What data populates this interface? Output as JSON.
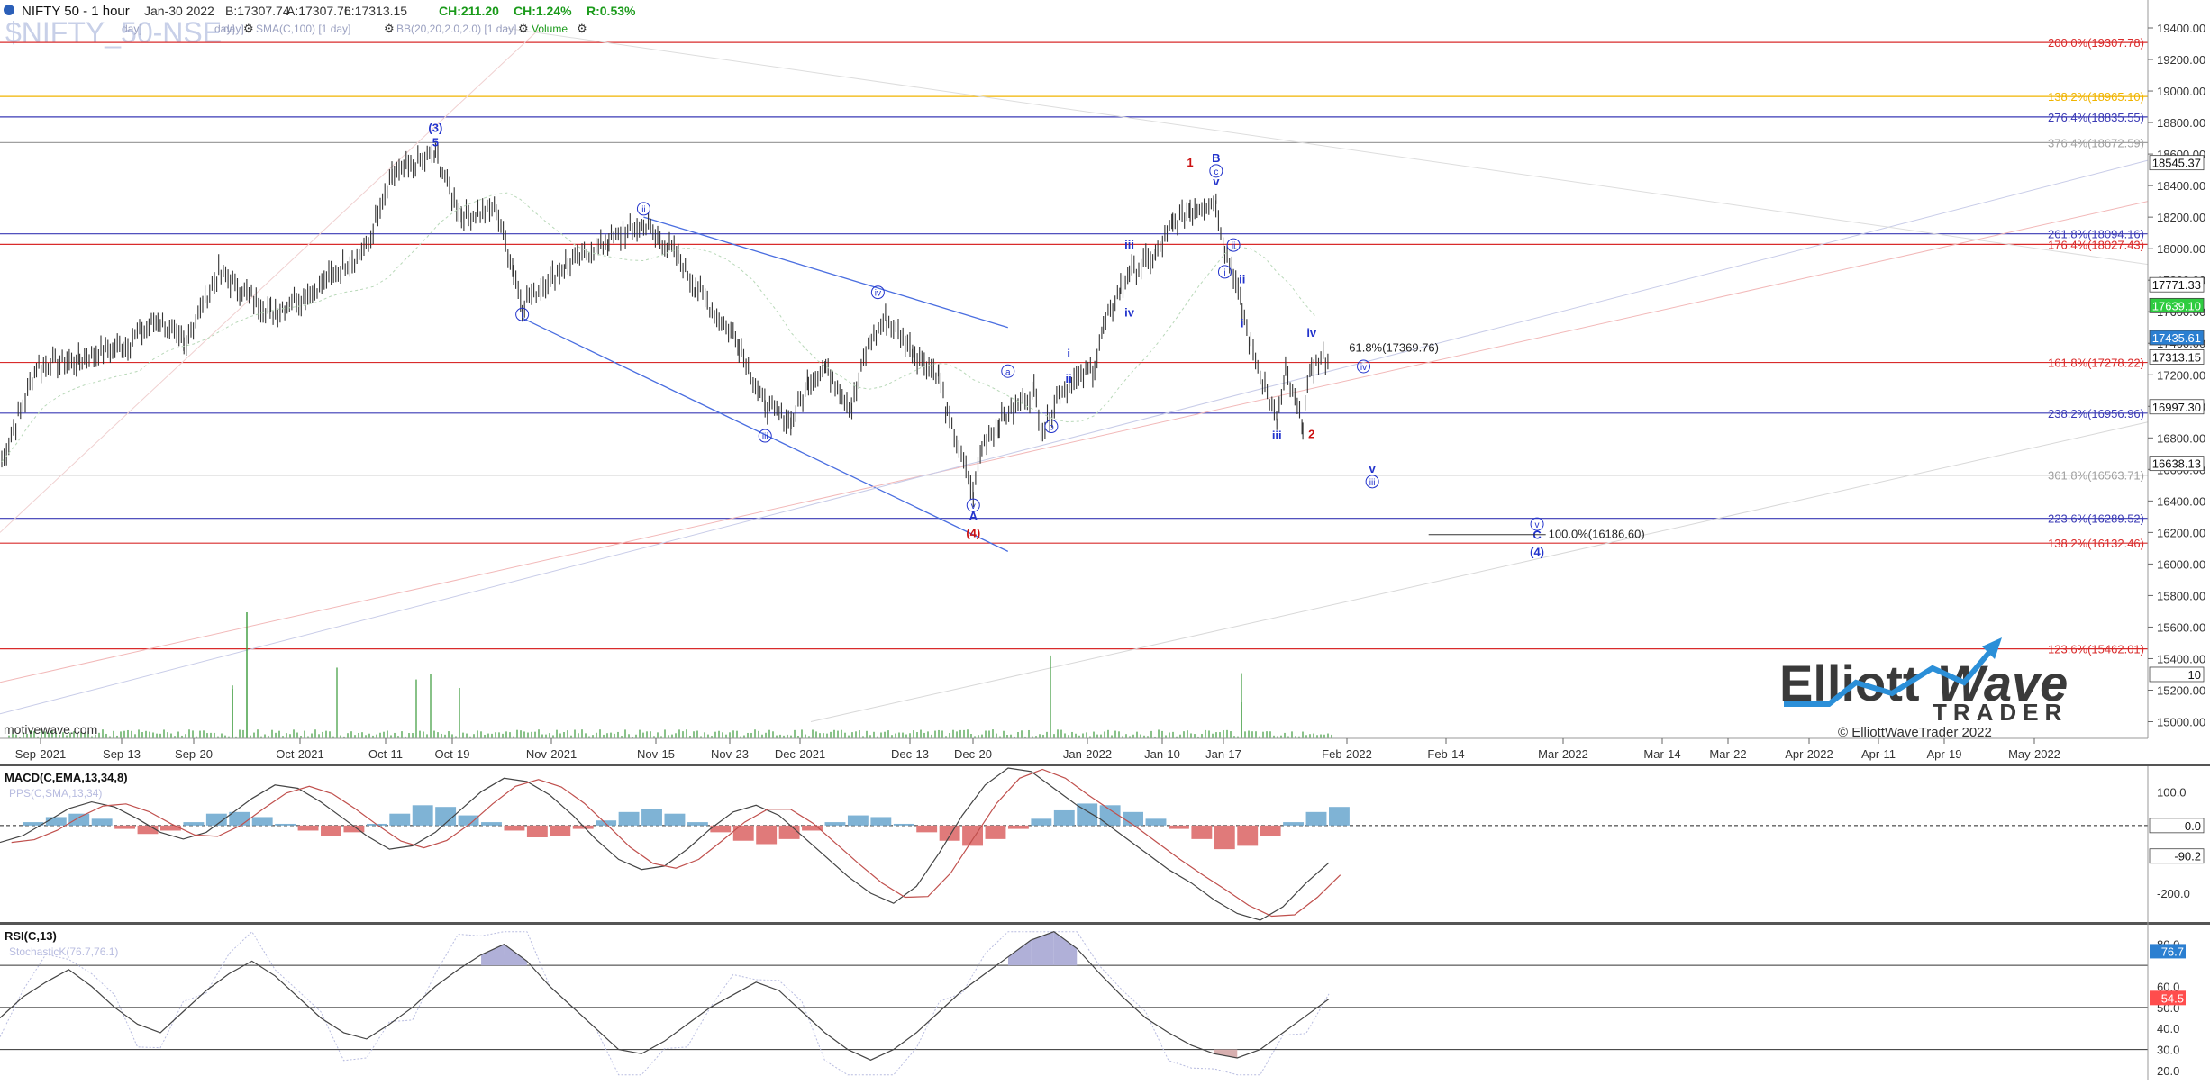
{
  "header": {
    "symbol_line": "NIFTY 50 - 1 hour",
    "quote_date": "Jan-30 2022",
    "bid": "B:17307.74",
    "ask": "A:17307.76",
    "last": "L:17313.15",
    "change": "CH:211.20",
    "change_pct": "CH:1.24%",
    "range": "R:0.53%",
    "watermark": "$NIFTY_50-NSE",
    "ind_sma": "SMA(C,100) [1 day]",
    "ind_bb": "BB(20,20,2.0,2.0) [1 day]",
    "ind_volume": "Volume",
    "ind_day_fragments": [
      "day]",
      "day]",
      "day]"
    ]
  },
  "footer": {
    "source": "motivewave.com",
    "copyright": "© ElliottWaveTrader 2022",
    "logo_word1": "Elliott",
    "logo_word2": "Wave",
    "logo_word3": "TRADER"
  },
  "colors": {
    "price_bars": "#333333",
    "fib_red": "#d92b2b",
    "fib_blue": "#3a3ab5",
    "fib_orange": "#f0b400",
    "fib_grey": "#a0a0a0",
    "wave_blue": "#2233cc",
    "wave_red": "#cc1111",
    "up_hist": "#7fb3d5",
    "down_hist": "#e07a7a",
    "volume": "#3a9a3a",
    "last_price_tag": "#2b7fd1",
    "green_tag": "#2ecc40",
    "rsi_overbought_fill": "#b0b0d8",
    "rsi_oversold_fill": "#d8b0b0"
  },
  "chart_data": [
    {
      "type": "line",
      "panel": "price",
      "title": "NIFTY 50 - 1 hour",
      "x_tick_labels": [
        "Sep-2021",
        "Sep-13",
        "Sep-20",
        "Oct-2021",
        "Oct-11",
        "Oct-19",
        "Nov-2021",
        "Nov-15",
        "Nov-23",
        "Dec-2021",
        "Dec-13",
        "Dec-20",
        "Jan-2022",
        "Jan-10",
        "Jan-17",
        "Feb-2022",
        "Feb-14",
        "Mar-2022",
        "Mar-14",
        "Mar-22",
        "Apr-2022",
        "Apr-11",
        "Apr-19",
        "May-2022"
      ],
      "y_tick_labels": [
        "15000.00",
        "15200.00",
        "15400.00",
        "15600.00",
        "15800.00",
        "16000.00",
        "16200.00",
        "16400.00",
        "16600.00",
        "16800.00",
        "17000.00",
        "17200.00",
        "17400.00",
        "17600.00",
        "17800.00",
        "18000.00",
        "18200.00",
        "18400.00",
        "18600.00",
        "18800.00",
        "19000.00",
        "19200.00",
        "19400.00"
      ],
      "ylim": [
        15000,
        19450
      ],
      "close_path": [
        {
          "x": "Aug-30",
          "y": 16650
        },
        {
          "x": "Sep-03",
          "y": 17250
        },
        {
          "x": "Sep-08",
          "y": 17300
        },
        {
          "x": "Sep-13",
          "y": 17380
        },
        {
          "x": "Sep-17",
          "y": 17550
        },
        {
          "x": "Sep-20",
          "y": 17400
        },
        {
          "x": "Sep-24",
          "y": 17850
        },
        {
          "x": "Sep-30",
          "y": 17600
        },
        {
          "x": "Oct-04",
          "y": 17700
        },
        {
          "x": "Oct-11",
          "y": 18000
        },
        {
          "x": "Oct-14",
          "y": 18450
        },
        {
          "x": "Oct-19",
          "y": 18600
        },
        {
          "x": "Oct-22",
          "y": 18200
        },
        {
          "x": "Oct-26",
          "y": 18250
        },
        {
          "x": "Oct-28",
          "y": 17850
        },
        {
          "x": "Oct-29",
          "y": 17650
        },
        {
          "x": "Nov-03",
          "y": 17900
        },
        {
          "x": "Nov-08",
          "y": 18050
        },
        {
          "x": "Nov-12",
          "y": 18150
        },
        {
          "x": "Nov-16",
          "y": 17950
        },
        {
          "x": "Nov-18",
          "y": 17750
        },
        {
          "x": "Nov-23",
          "y": 17400
        },
        {
          "x": "Nov-26",
          "y": 17000
        },
        {
          "x": "Nov-29",
          "y": 16900
        },
        {
          "x": "Dec-01",
          "y": 17150
        },
        {
          "x": "Dec-03",
          "y": 17250
        },
        {
          "x": "Dec-06",
          "y": 17000
        },
        {
          "x": "Dec-08",
          "y": 17400
        },
        {
          "x": "Dec-10",
          "y": 17550
        },
        {
          "x": "Dec-13",
          "y": 17350
        },
        {
          "x": "Dec-16",
          "y": 17200
        },
        {
          "x": "Dec-17",
          "y": 16950
        },
        {
          "x": "Dec-20",
          "y": 16450
        },
        {
          "x": "Dec-21",
          "y": 16750
        },
        {
          "x": "Dec-23",
          "y": 16900
        },
        {
          "x": "Dec-27",
          "y": 17100
        },
        {
          "x": "Dec-28",
          "y": 16850
        },
        {
          "x": "Dec-30",
          "y": 17100
        },
        {
          "x": "Jan-03",
          "y": 17250
        },
        {
          "x": "Jan-04",
          "y": 17500
        },
        {
          "x": "Jan-06",
          "y": 17750
        },
        {
          "x": "Jan-07",
          "y": 17850
        },
        {
          "x": "Jan-10",
          "y": 17950
        },
        {
          "x": "Jan-12",
          "y": 18150
        },
        {
          "x": "Jan-14",
          "y": 18250
        },
        {
          "x": "Jan-17",
          "y": 18300
        },
        {
          "x": "Jan-18",
          "y": 18000
        },
        {
          "x": "Jan-19",
          "y": 17850
        },
        {
          "x": "Jan-20",
          "y": 17600
        },
        {
          "x": "Jan-21",
          "y": 17400
        },
        {
          "x": "Jan-24",
          "y": 16900
        },
        {
          "x": "Jan-25",
          "y": 17200
        },
        {
          "x": "Jan-27",
          "y": 16900
        },
        {
          "x": "Jan-28",
          "y": 17250
        },
        {
          "x": "Jan-30",
          "y": 17313.15
        }
      ],
      "fib_levels": [
        {
          "label": "200.0%(19307.78)",
          "value": 19307.78,
          "color": "#d92b2b"
        },
        {
          "label": "138.2%(18965.10)",
          "value": 18965.1,
          "color": "#f0b400"
        },
        {
          "label": "276.4%(18835.55)",
          "value": 18835.55,
          "color": "#3a3ab5"
        },
        {
          "label": "376.4%(18672.59)",
          "value": 18672.59,
          "color": "#a0a0a0"
        },
        {
          "label": "261.8%(18094.16)",
          "value": 18094.16,
          "color": "#3a3ab5"
        },
        {
          "label": "176.4%(18027.43)",
          "value": 18027.43,
          "color": "#d92b2b"
        },
        {
          "label": "161.8%(17278.22)",
          "value": 17278.22,
          "color": "#d92b2b"
        },
        {
          "label": "238.2%(16956.96)",
          "value": 16956.96,
          "color": "#3a3ab5"
        },
        {
          "label": "361.8%(16563.71)",
          "value": 16563.71,
          "color": "#a0a0a0"
        },
        {
          "label": "223.6%(16289.52)",
          "value": 16289.52,
          "color": "#3a3ab5"
        },
        {
          "label": "138.2%(16132.46)",
          "value": 16132.46,
          "color": "#d92b2b"
        },
        {
          "label": "123.6%(15462.01)",
          "value": 15462.01,
          "color": "#d92b2b"
        }
      ],
      "price_tags": [
        {
          "label": "18545.37",
          "value": 18545.37,
          "color": "#ffffff"
        },
        {
          "label": "17771.33",
          "value": 17771.33,
          "color": "#ffffff"
        },
        {
          "label": "17639.10",
          "value": 17639.1,
          "color": "#2ecc40"
        },
        {
          "label": "17435.61",
          "value": 17435.61,
          "color": "#2b7fd1"
        },
        {
          "label": "17313.15",
          "value": 17313.15,
          "color": "#ffffff"
        },
        {
          "label": "16997.30",
          "value": 16997.3,
          "color": "#ffffff"
        },
        {
          "label": "16638.13",
          "value": 16638.13,
          "color": "#ffffff"
        },
        {
          "label": "10",
          "value": 15300,
          "color": "#ffffff"
        }
      ],
      "annotations": [
        {
          "text": "61.8%(17369.76)",
          "x": "Feb-01",
          "y": 17369.76
        },
        {
          "text": "100.0%(16186.60)",
          "x": "Feb-24",
          "y": 16186.6
        }
      ],
      "wave_labels": [
        {
          "text": "(3)",
          "x": "Oct-19",
          "y": 18740,
          "color": "#2233cc",
          "circled": false
        },
        {
          "text": "5",
          "x": "Oct-19",
          "y": 18650,
          "color": "#2233cc",
          "circled": false
        },
        {
          "text": "ii",
          "x": "Nov-12",
          "y": 18230,
          "color": "#2233cc",
          "circled": true
        },
        {
          "text": "i",
          "x": "Oct-29",
          "y": 17560,
          "color": "#2233cc",
          "circled": true
        },
        {
          "text": "iv",
          "x": "Dec-09",
          "y": 17700,
          "color": "#2233cc",
          "circled": true
        },
        {
          "text": "iii",
          "x": "Nov-26",
          "y": 16790,
          "color": "#2233cc",
          "circled": true
        },
        {
          "text": "a",
          "x": "Dec-24",
          "y": 17200,
          "color": "#2233cc",
          "circled": true
        },
        {
          "text": "b",
          "x": "Dec-29",
          "y": 16850,
          "color": "#2233cc",
          "circled": true
        },
        {
          "text": "v",
          "x": "Dec-20",
          "y": 16350,
          "color": "#2233cc",
          "circled": true
        },
        {
          "text": "A",
          "x": "Dec-20",
          "y": 16280,
          "color": "#2233cc",
          "circled": false
        },
        {
          "text": "(4)",
          "x": "Dec-20",
          "y": 16170,
          "color": "#cc1111",
          "circled": false
        },
        {
          "text": "i",
          "x": "Dec-31",
          "y": 17310,
          "color": "#2233cc",
          "circled": false
        },
        {
          "text": "ii",
          "x": "Dec-31",
          "y": 17150,
          "color": "#2233cc",
          "circled": false
        },
        {
          "text": "iii",
          "x": "Jan-07",
          "y": 18000,
          "color": "#2233cc",
          "circled": false
        },
        {
          "text": "iv",
          "x": "Jan-07",
          "y": 17570,
          "color": "#2233cc",
          "circled": false
        },
        {
          "text": "1",
          "x": "Jan-14",
          "y": 18520,
          "color": "#cc1111",
          "circled": false
        },
        {
          "text": "B",
          "x": "Jan-17",
          "y": 18550,
          "color": "#2233cc",
          "circled": false
        },
        {
          "text": "c",
          "x": "Jan-17",
          "y": 18470,
          "color": "#2233cc",
          "circled": true
        },
        {
          "text": "v",
          "x": "Jan-17",
          "y": 18400,
          "color": "#2233cc",
          "circled": false
        },
        {
          "text": "ii",
          "x": "Jan-19",
          "y": 18000,
          "color": "#2233cc",
          "circled": true
        },
        {
          "text": "i",
          "x": "Jan-18",
          "y": 17830,
          "color": "#2233cc",
          "circled": true
        },
        {
          "text": "ii",
          "x": "Jan-20",
          "y": 17780,
          "color": "#2233cc",
          "circled": false
        },
        {
          "text": "i",
          "x": "Jan-20",
          "y": 17500,
          "color": "#2233cc",
          "circled": false
        },
        {
          "text": "iii",
          "x": "Jan-24",
          "y": 16790,
          "color": "#2233cc",
          "circled": false
        },
        {
          "text": "iv",
          "x": "Jan-28",
          "y": 17440,
          "color": "#2233cc",
          "circled": false
        },
        {
          "text": "2",
          "x": "Jan-28",
          "y": 16800,
          "color": "#cc1111",
          "circled": false
        },
        {
          "text": "iv",
          "x": "Feb-03",
          "y": 17230,
          "color": "#2233cc",
          "circled": true
        },
        {
          "text": "v",
          "x": "Feb-04",
          "y": 16580,
          "color": "#2233cc",
          "circled": false
        },
        {
          "text": "iii",
          "x": "Feb-04",
          "y": 16500,
          "color": "#2233cc",
          "circled": true
        },
        {
          "text": "v",
          "x": "Feb-23",
          "y": 16230,
          "color": "#2233cc",
          "circled": true
        },
        {
          "text": "C",
          "x": "Feb-23",
          "y": 16160,
          "color": "#2233cc",
          "circled": false
        },
        {
          "text": "(4)",
          "x": "Feb-23",
          "y": 16050,
          "color": "#2233cc",
          "circled": false
        }
      ]
    },
    {
      "type": "bar",
      "panel": "macd",
      "title": "MACD(C,EMA,13,34,8)",
      "legend_faint": "PPS(C,SMA,13,34)",
      "y_tick_labels": [
        "100.0",
        "-200.0"
      ],
      "ylim": [
        -280,
        170
      ],
      "zero_label": "-0.0",
      "last_label": "-90.2",
      "histogram": [
        0,
        10,
        25,
        35,
        20,
        -10,
        -25,
        -15,
        10,
        35,
        40,
        25,
        5,
        -15,
        -30,
        -20,
        5,
        35,
        60,
        55,
        30,
        10,
        -15,
        -35,
        -30,
        -10,
        15,
        40,
        50,
        35,
        10,
        -20,
        -45,
        -55,
        -40,
        -15,
        10,
        30,
        25,
        5,
        -20,
        -45,
        -60,
        -40,
        -10,
        20,
        45,
        65,
        60,
        40,
        20,
        -10,
        -40,
        -70,
        -60,
        -30,
        10,
        40,
        55
      ],
      "macd_line": [
        -50,
        -30,
        10,
        50,
        70,
        55,
        20,
        -20,
        -40,
        -20,
        30,
        80,
        120,
        110,
        70,
        20,
        -30,
        -70,
        -60,
        -20,
        40,
        100,
        140,
        130,
        90,
        30,
        -40,
        -100,
        -130,
        -120,
        -70,
        -10,
        40,
        60,
        30,
        -30,
        -90,
        -150,
        -200,
        -230,
        -180,
        -80,
        30,
        120,
        170,
        160,
        110,
        60,
        20,
        -30,
        -80,
        -130,
        -170,
        -220,
        -260,
        -280,
        -240,
        -170,
        -110
      ]
    },
    {
      "type": "line",
      "panel": "rsi",
      "title": "RSI(C,13)",
      "legend_faint": "StochasticK(76.7,76.1)",
      "y_tick_labels": [
        "80.0",
        "60.0",
        "50.0",
        "40.0",
        "30.0",
        "20.0"
      ],
      "ylim": [
        17,
        88
      ],
      "hlines": [
        70,
        50,
        30
      ],
      "last_labels": [
        "76.7",
        "54.5"
      ],
      "rsi": [
        45,
        55,
        62,
        68,
        60,
        50,
        42,
        38,
        48,
        58,
        66,
        72,
        65,
        55,
        45,
        38,
        35,
        42,
        50,
        60,
        68,
        75,
        80,
        72,
        60,
        50,
        40,
        30,
        28,
        34,
        42,
        50,
        56,
        62,
        58,
        48,
        38,
        30,
        25,
        30,
        38,
        48,
        58,
        66,
        74,
        82,
        86,
        78,
        66,
        55,
        45,
        38,
        32,
        28,
        26,
        30,
        38,
        46,
        54
      ]
    }
  ]
}
